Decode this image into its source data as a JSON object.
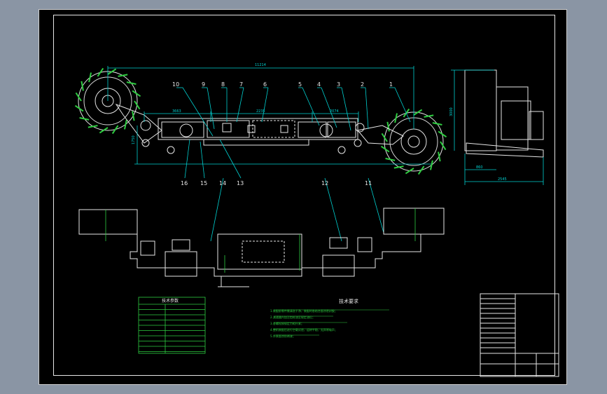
{
  "drawing": {
    "callouts_top": [
      "10",
      "9",
      "8",
      "7",
      "6",
      "5",
      "4",
      "3",
      "2",
      "1"
    ],
    "callouts_bottom": [
      "16",
      "15",
      "14",
      "13",
      "12",
      "11"
    ],
    "dimensions": {
      "overall": "11214",
      "left_span": "3663",
      "mid_span": "2235",
      "right_span": "2074",
      "height_left": "1750",
      "side_height": "3000",
      "side_width_a": "860",
      "side_width_b": "2545"
    },
    "spec_table_title": "技术参数",
    "notes_title": "技术要求",
    "notes": [
      "1.装配前零件需清洗干净，装配时各结合面涂密封胶；",
      "2.减速器内加注齿轮油至规定油位；",
      "3.各螺栓按规定力矩拧紧；",
      "4.整机装配后进行空载试验，运转平稳，无异常噪声；",
      "5.外表面涂防锈漆；"
    ]
  }
}
